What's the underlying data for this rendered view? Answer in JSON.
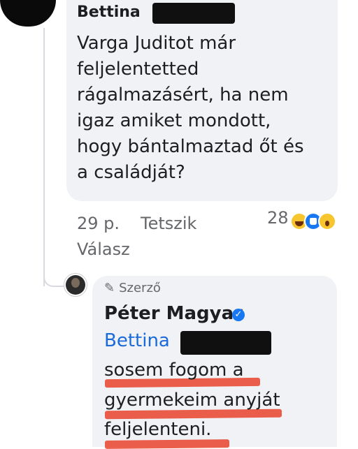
{
  "comment": {
    "author": "Bettina",
    "text": "Varga Juditot már\nfeljelentetted\nrágalmazásért, ha nem\nigaz amiket mondott,\nhogy bántalmaztad őt és\na családját?",
    "time": "29 p.",
    "like_label": "Tetszik",
    "reply_label": "Válasz",
    "reaction_count": "28",
    "reactions": [
      "haha-icon",
      "like-icon",
      "wow-icon"
    ]
  },
  "reply": {
    "author_badge": "Szerző",
    "author": "Péter Magyar",
    "mention": "Bettina",
    "lines": [
      "sosem fogom a",
      "gyermekeim anyját",
      "feljelenteni."
    ]
  },
  "colors": {
    "bubble": "#f0f2f5",
    "mention": "#1b6ad9",
    "annotation": "#e8432b",
    "verified": "#1877f2"
  }
}
